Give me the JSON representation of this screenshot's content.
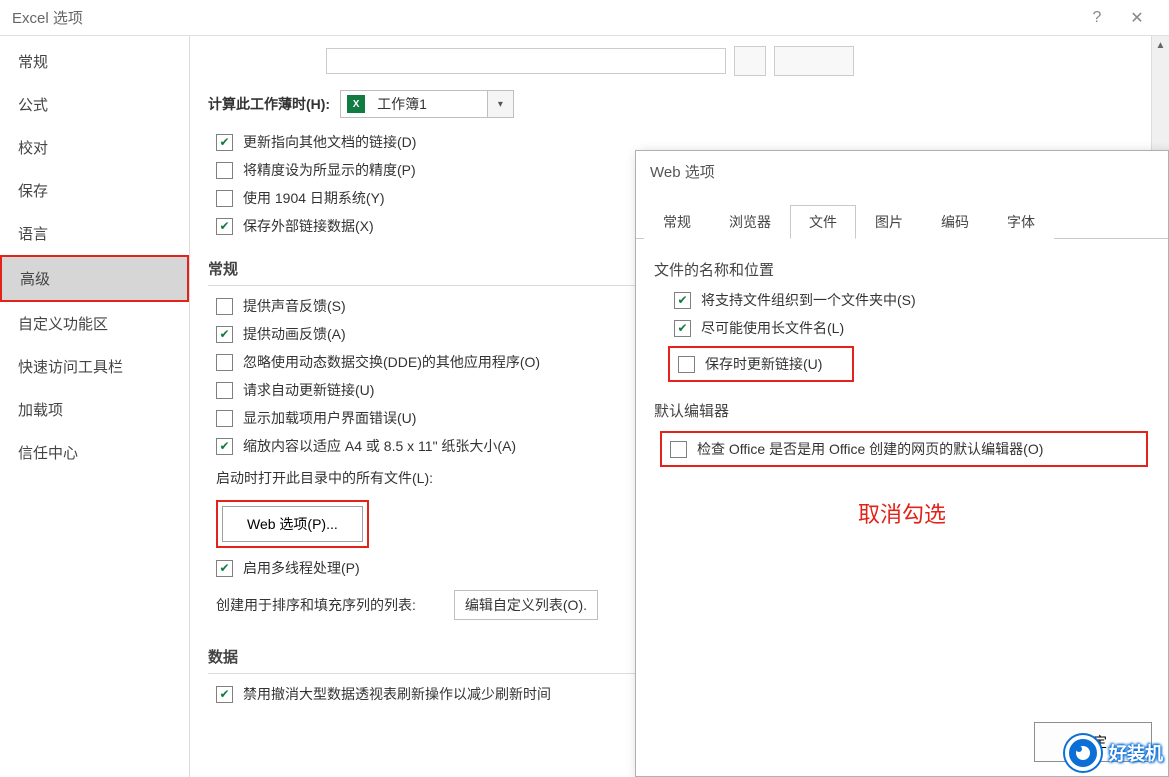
{
  "window": {
    "title": "Excel 选项"
  },
  "sidebar": {
    "items": [
      {
        "label": "常规"
      },
      {
        "label": "公式"
      },
      {
        "label": "校对"
      },
      {
        "label": "保存"
      },
      {
        "label": "语言"
      },
      {
        "label": "高级",
        "active": true,
        "highlight": true
      },
      {
        "label": "自定义功能区"
      },
      {
        "label": "快速访问工具栏"
      },
      {
        "label": "加载项"
      },
      {
        "label": "信任中心"
      }
    ]
  },
  "content": {
    "workbook_calc_label": "计算此工作薄时(H):",
    "workbook_calc_value": "工作簿1",
    "update_links": "更新指向其他文档的链接(D)",
    "set_precision": "将精度设为所显示的精度(P)",
    "use_1904": "使用 1904 日期系统(Y)",
    "save_external": "保存外部链接数据(X)",
    "general_heading": "常规",
    "sound_feedback": "提供声音反馈(S)",
    "anim_feedback": "提供动画反馈(A)",
    "ignore_dde": "忽略使用动态数据交换(DDE)的其他应用程序(O)",
    "ask_update": "请求自动更新链接(U)",
    "addin_errors": "显示加载项用户界面错误(U)",
    "scale_a4": "缩放内容以适应 A4 或 8.5 x 11\" 纸张大小(A)",
    "startup_files_label": "启动时打开此目录中的所有文件(L):",
    "web_options_btn": "Web 选项(P)...",
    "multithread": "启用多线程处理(P)",
    "sort_lists_label": "创建用于排序和填充序列的列表:",
    "edit_custom_btn": "编辑自定义列表(O).",
    "data_heading": "数据",
    "undo_pivottable": "禁用撤消大型数据透视表刷新操作以减少刷新时间"
  },
  "dialog": {
    "title": "Web 选项",
    "tabs": [
      {
        "label": "常规"
      },
      {
        "label": "浏览器"
      },
      {
        "label": "文件",
        "active": true
      },
      {
        "label": "图片"
      },
      {
        "label": "编码"
      },
      {
        "label": "字体"
      }
    ],
    "file_group_title": "文件的名称和位置",
    "organize_folder": "将支持文件组织到一个文件夹中(S)",
    "long_filenames": "尽可能使用长文件名(L)",
    "update_on_save": "保存时更新链接(U)",
    "editor_group_title": "默认编辑器",
    "check_office_default": "检查 Office 是否是用 Office 创建的网页的默认编辑器(O)",
    "annotation": "取消勾选",
    "ok_btn": "确定"
  },
  "watermark": {
    "text": "好装机"
  }
}
